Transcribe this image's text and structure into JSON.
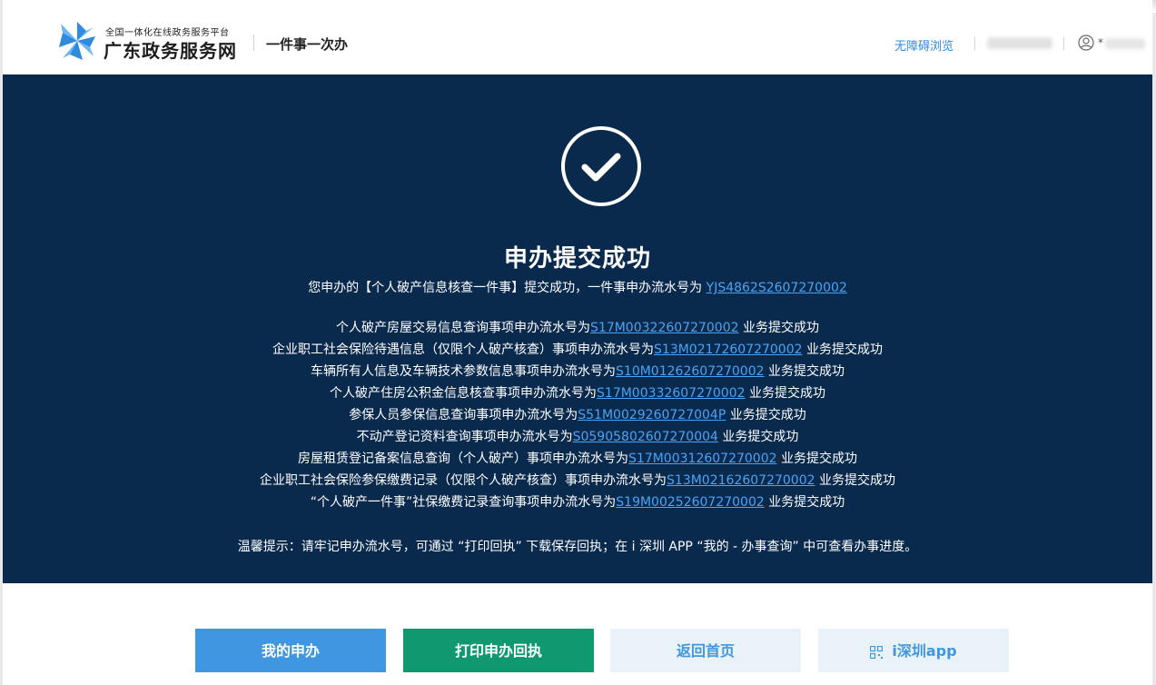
{
  "header": {
    "platform_sub": "全国一体化在线政务服务平台",
    "platform_name": "广东政务服务网",
    "section_title": "一件事一次办",
    "accessibility_link": "无障碍浏览",
    "user_initial": "*"
  },
  "result": {
    "title": "申办提交成功",
    "summary_prefix": "您申办的【个人破产信息核查一件事】提交成功，一件事申办流水号为",
    "summary_serial": "YJS4862S2607270002",
    "items": [
      {
        "prefix": "个人破产房屋交易信息查询事项申办流水号为",
        "serial": "S17M00322607270002",
        "suffix": "业务提交成功"
      },
      {
        "prefix": "企业职工社会保险待遇信息（仅限个人破产核查）事项申办流水号为",
        "serial": "S13M02172607270002",
        "suffix": "业务提交成功"
      },
      {
        "prefix": "车辆所有人信息及车辆技术参数信息事项申办流水号为",
        "serial": "S10M01262607270002",
        "suffix": "业务提交成功"
      },
      {
        "prefix": "个人破产住房公积金信息核查事项申办流水号为",
        "serial": "S17M00332607270002",
        "suffix": "业务提交成功"
      },
      {
        "prefix": "参保人员参保信息查询事项申办流水号为",
        "serial": "S51M0029260727004P",
        "suffix": "业务提交成功"
      },
      {
        "prefix": "不动产登记资料查询事项申办流水号为",
        "serial": "S05905802607270004",
        "suffix": "业务提交成功"
      },
      {
        "prefix": "房屋租赁登记备案信息查询（个人破产）事项申办流水号为",
        "serial": "S17M00312607270002",
        "suffix": "业务提交成功"
      },
      {
        "prefix": "企业职工社会保险参保缴费记录（仅限个人破产核查）事项申办流水号为",
        "serial": "S13M02162607270002",
        "suffix": "业务提交成功"
      },
      {
        "prefix": "“个人破产一件事”社保缴费记录查询事项申办流水号为",
        "serial": "S19M00252607270002",
        "suffix": "业务提交成功"
      }
    ],
    "tip": "温馨提示：请牢记申办流水号，可通过 “打印回执” 下载保存回执；在 i 深圳 APP “我的 - 办事查询” 中可查看办事进度。"
  },
  "buttons": {
    "my_applications": "我的申办",
    "print_receipt": "打印申办回执",
    "back_home": "返回首页",
    "app": "i深圳app"
  },
  "icons": {
    "logo": "pinwheel-logo-icon",
    "success": "check-circle-icon",
    "user": "user-icon",
    "qr": "qr-code-icon"
  },
  "colors": {
    "banner_bg": "#0a2a4d",
    "link": "#4aa3f5",
    "primary_button": "#3e97e0",
    "print_button": "#109970",
    "light_button": "#e9f1f9"
  }
}
